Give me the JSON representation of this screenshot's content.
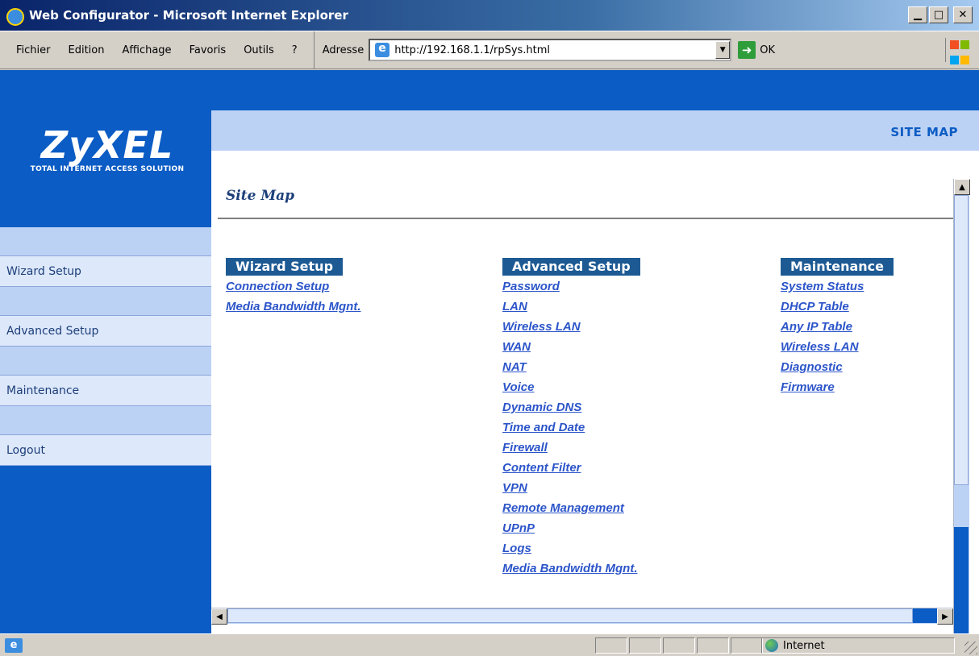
{
  "window": {
    "title": "Web Configurator - Microsoft Internet Explorer",
    "min_glyph": "▁",
    "max_glyph": "□",
    "close_glyph": "✕"
  },
  "menu": {
    "items": [
      "Fichier",
      "Edition",
      "Affichage",
      "Favoris",
      "Outils",
      "?"
    ]
  },
  "address": {
    "label": "Adresse",
    "url": "http://192.168.1.1/rpSys.html",
    "go_label": "OK"
  },
  "brand": {
    "name": "ZyXEL",
    "tagline": "TOTAL INTERNET ACCESS SOLUTION",
    "primary_color": "#0b5cc4",
    "light_color": "#bcd2f5"
  },
  "header": {
    "section_tag": "SITE MAP"
  },
  "sidebar": {
    "items": [
      {
        "label": "Wizard Setup"
      },
      {
        "label": "Advanced Setup"
      },
      {
        "label": "Maintenance"
      },
      {
        "label": "Logout"
      }
    ]
  },
  "main": {
    "title": "Site Map",
    "columns": [
      {
        "heading": "Wizard Setup",
        "links": [
          "Connection Setup",
          "Media Bandwidth Mgnt."
        ]
      },
      {
        "heading": "Advanced Setup",
        "links": [
          "Password",
          "LAN",
          "Wireless LAN",
          "WAN",
          "NAT",
          "Voice",
          "Dynamic DNS",
          "Time and Date",
          "Firewall",
          "Content Filter",
          "VPN",
          "Remote Management",
          "UPnP",
          "Logs",
          "Media Bandwidth Mgnt."
        ]
      },
      {
        "heading": "Maintenance",
        "links": [
          "System Status",
          "DHCP Table",
          "Any IP Table",
          "Wireless LAN",
          "Diagnostic",
          "Firmware"
        ]
      }
    ]
  },
  "statusbar": {
    "zone": "Internet"
  }
}
